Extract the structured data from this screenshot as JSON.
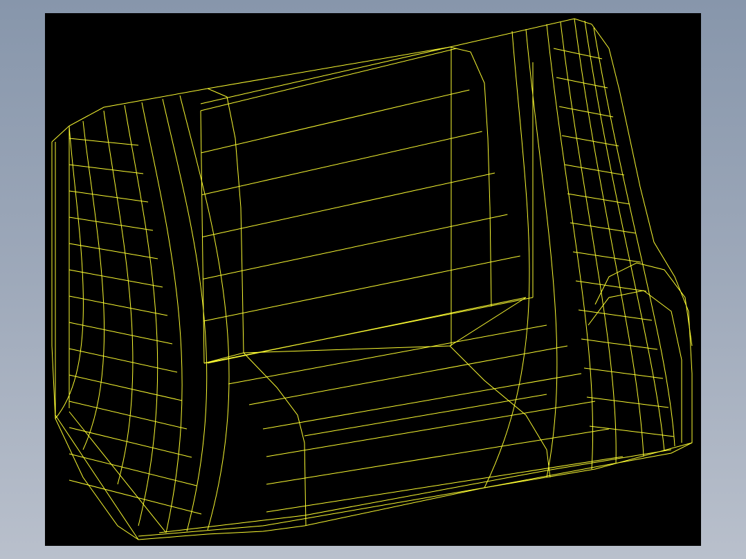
{
  "viewport": {
    "background_color": "#000000",
    "wire_color": "#ffff33"
  },
  "page": {
    "background_top": "#8796ab",
    "background_bottom": "#b9c0cc"
  },
  "model": {
    "kind": "wireframe-3d-seat"
  }
}
